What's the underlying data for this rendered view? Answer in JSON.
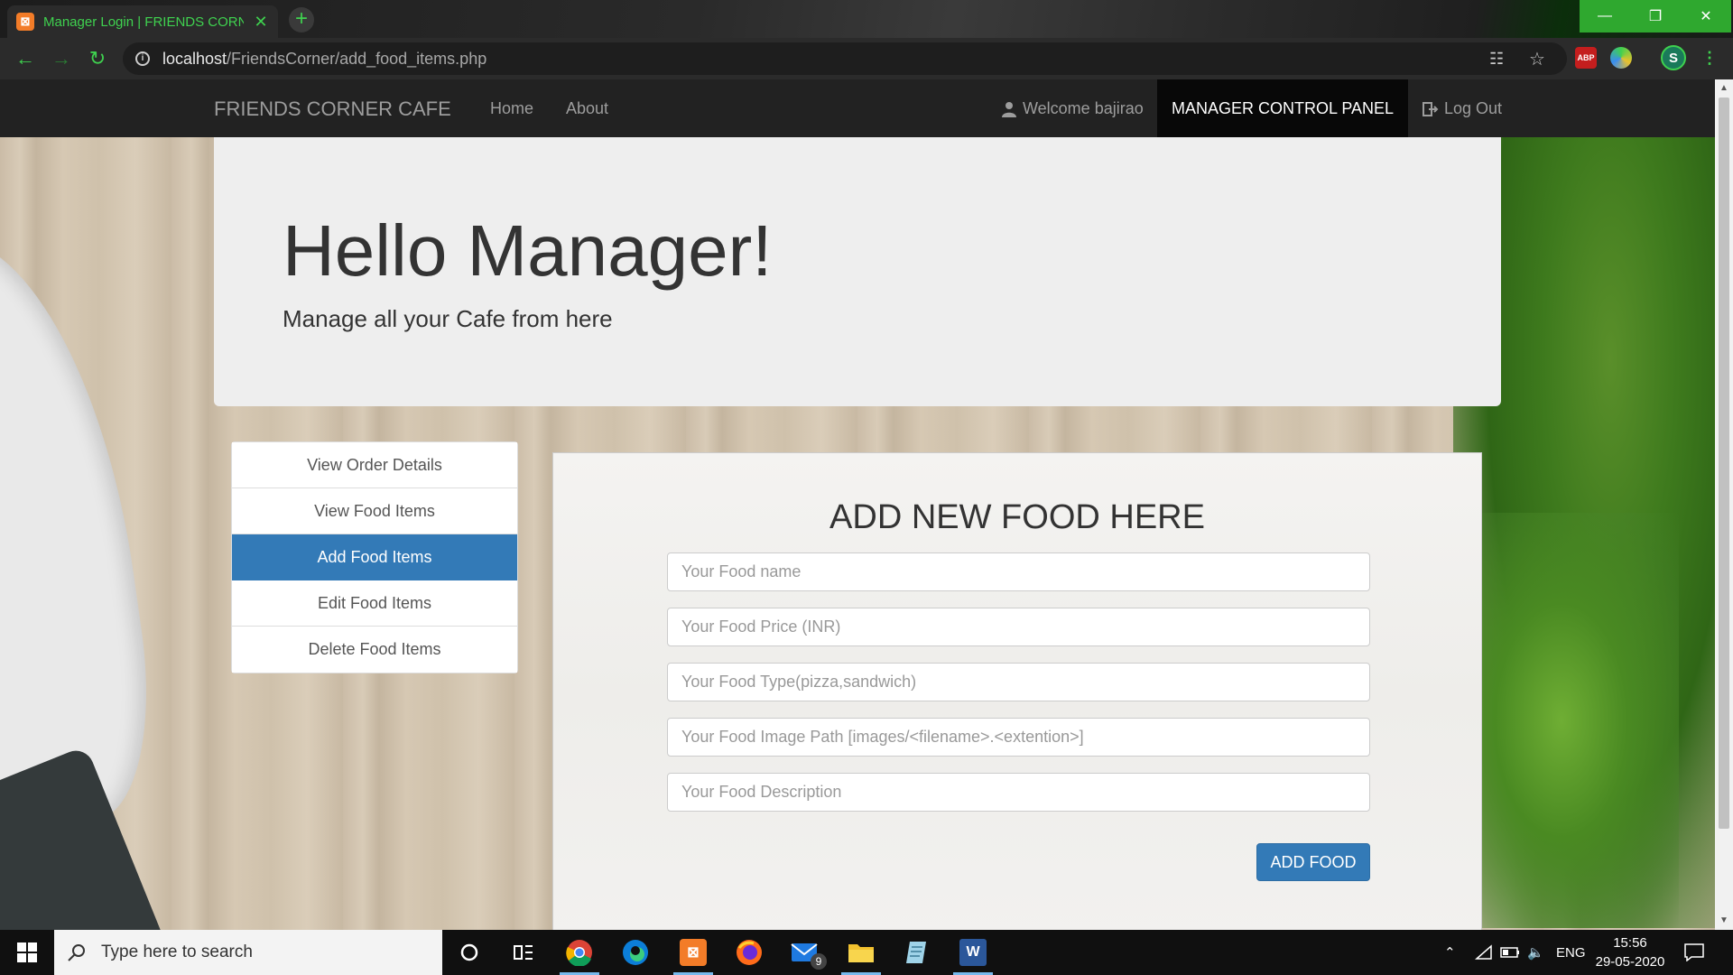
{
  "browser": {
    "tab_title": "Manager Login | FRIENDS CORNER CAFE",
    "url_host": "localhost",
    "url_path": "/FriendsCorner/add_food_items.php",
    "profile_initial": "S",
    "abp_label": "ABP"
  },
  "navbar": {
    "brand": "FRIENDS CORNER CAFE",
    "links": [
      "Home",
      "About"
    ],
    "welcome": "Welcome bajirao",
    "panel": "MANAGER CONTROL PANEL",
    "logout": "Log Out"
  },
  "jumbotron": {
    "heading": "Hello Manager!",
    "subheading": "Manage all your Cafe from here"
  },
  "sidebar": {
    "items": [
      {
        "label": "View Order Details",
        "active": false
      },
      {
        "label": "View Food Items",
        "active": false
      },
      {
        "label": "Add Food Items",
        "active": true
      },
      {
        "label": "Edit Food Items",
        "active": false
      },
      {
        "label": "Delete Food Items",
        "active": false
      }
    ]
  },
  "form": {
    "title": "ADD NEW FOOD HERE",
    "fields": [
      {
        "placeholder": "Your Food name",
        "value": ""
      },
      {
        "placeholder": "Your Food Price (INR)",
        "value": ""
      },
      {
        "placeholder": "Your Food Type(pizza,sandwich)",
        "value": ""
      },
      {
        "placeholder": "Your Food Image Path [images/<filename>.<extention>]",
        "value": ""
      },
      {
        "placeholder": "Your Food Description",
        "value": ""
      }
    ],
    "submit_label": "ADD FOOD"
  },
  "taskbar": {
    "search_placeholder": "Type here to search",
    "mail_badge": "9",
    "language": "ENG",
    "time": "15:56",
    "date": "29-05-2020"
  },
  "colors": {
    "primary": "#337ab7",
    "navbar": "#222222",
    "tab_accent": "#3fd14f"
  }
}
